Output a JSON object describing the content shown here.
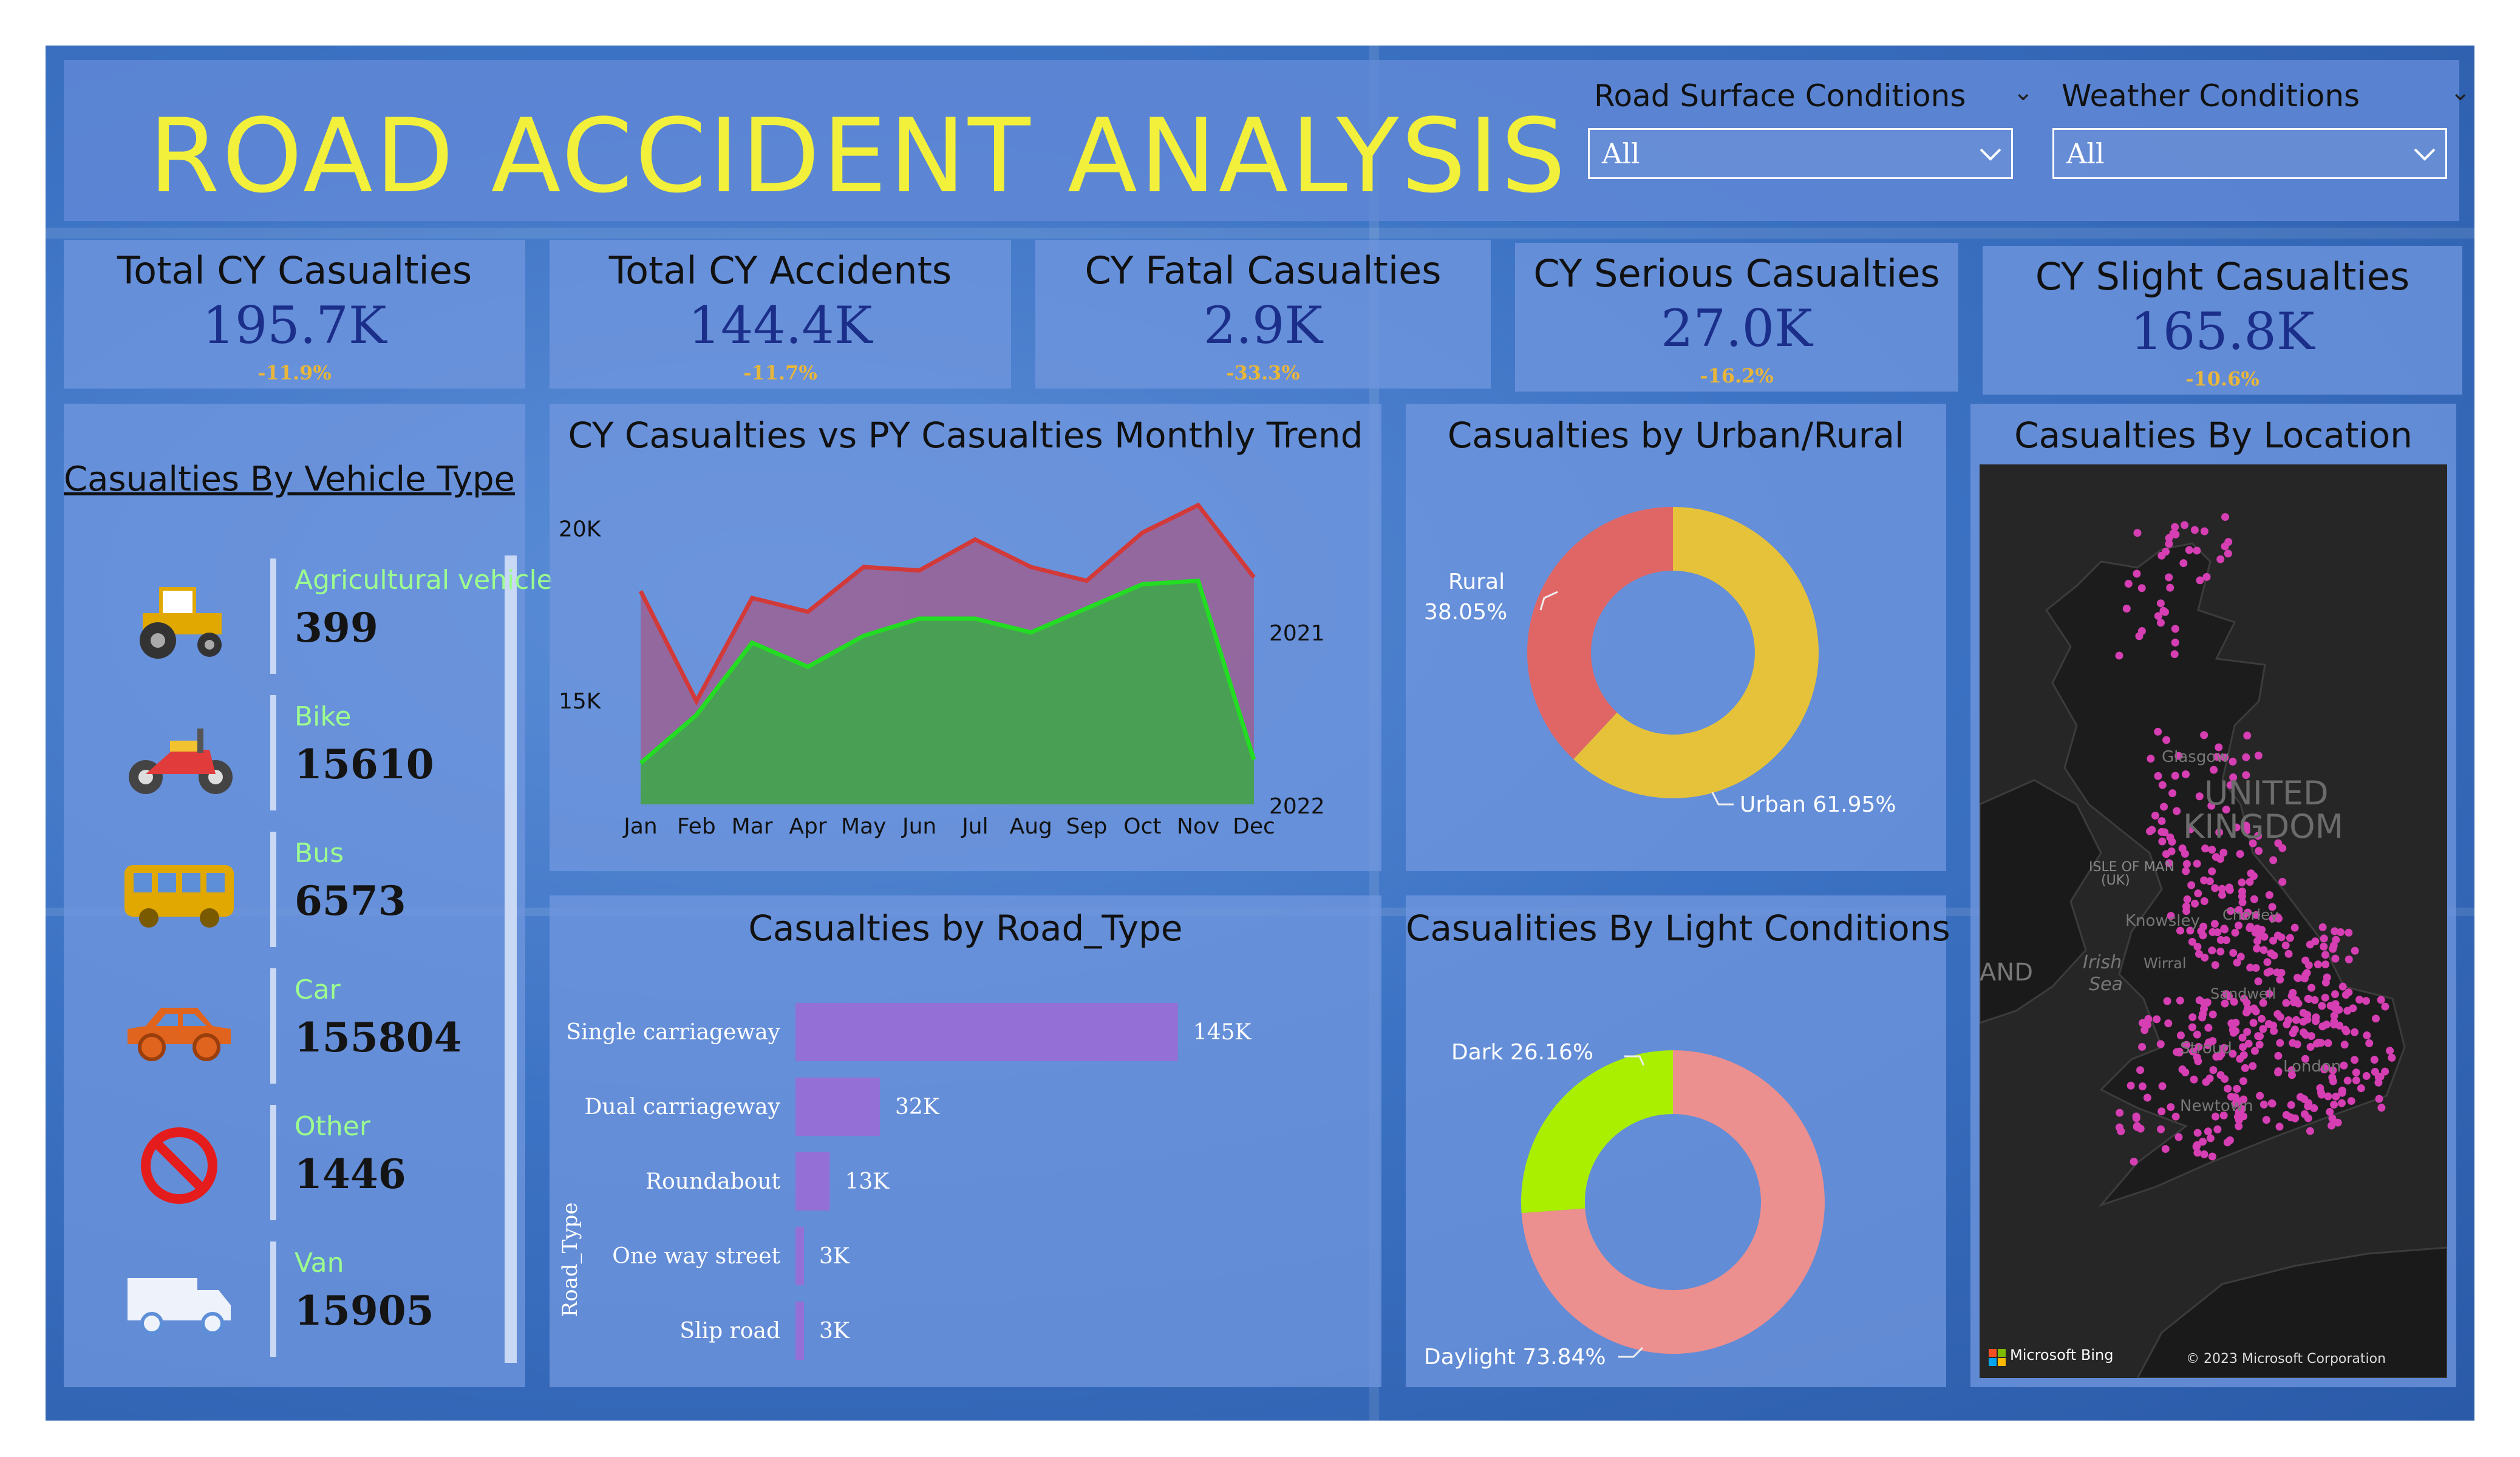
{
  "header": {
    "title": "ROAD ACCIDENT ANALYSIS"
  },
  "filters": [
    {
      "label": "Road Surface Conditions",
      "value": "All"
    },
    {
      "label": "Weather Conditions",
      "value": "All"
    }
  ],
  "kpis": [
    {
      "title": "Total CY Casualties",
      "value": "195.7K",
      "change": "-11.9%"
    },
    {
      "title": "Total CY Accidents",
      "value": "144.4K",
      "change": "-11.7%"
    },
    {
      "title": "CY Fatal Casualties",
      "value": "2.9K",
      "change": "-33.3%"
    },
    {
      "title": "CY Serious Casualties",
      "value": "27.0K",
      "change": "-16.2%"
    },
    {
      "title": "CY Slight Casualties",
      "value": "165.8K",
      "change": "-10.6%"
    }
  ],
  "vehicle_panel": {
    "title": "Casualties By Vehicle Type",
    "items": [
      {
        "label": "Agricultural vehicle",
        "value": "399",
        "icon": "tractor-icon"
      },
      {
        "label": "Bike",
        "value": "15610",
        "icon": "motorbike-icon"
      },
      {
        "label": "Bus",
        "value": "6573",
        "icon": "bus-icon"
      },
      {
        "label": "Car",
        "value": "155804",
        "icon": "car-icon"
      },
      {
        "label": "Other",
        "value": "1446",
        "icon": "no-entry-icon"
      },
      {
        "label": "Van",
        "value": "15905",
        "icon": "van-icon"
      }
    ]
  },
  "colors": {
    "title_yellow": "#f2f03a",
    "kpi_value": "#1b2f8a",
    "kpi_change": "#e8b63a",
    "py_line": "#d23a3a",
    "cy_line": "#22dd22",
    "rural": "#e06666",
    "urban": "#e6c23a",
    "dark": "#aaee00",
    "daylight": "#ec8f8f",
    "bar": "#9470d6",
    "map_point": "#d63fb3"
  },
  "chart_data": [
    {
      "type": "area",
      "title": "CY Casualties vs PY Casualties Monthly Trend",
      "x": [
        "Jan",
        "Feb",
        "Mar",
        "Apr",
        "May",
        "Jun",
        "Jul",
        "Aug",
        "Sep",
        "Oct",
        "Nov",
        "Dec"
      ],
      "y_ticks": [
        "20K",
        "15K"
      ],
      "ylim": [
        12000,
        21000
      ],
      "series": [
        {
          "name": "2021",
          "values": [
            18200,
            15000,
            18000,
            17600,
            18900,
            18800,
            19700,
            18900,
            18500,
            19900,
            20700,
            18600
          ]
        },
        {
          "name": "2022",
          "values": [
            13200,
            14600,
            16700,
            16000,
            16900,
            17400,
            17400,
            17000,
            17700,
            18400,
            18500,
            13300
          ]
        }
      ]
    },
    {
      "type": "pie",
      "title": "Casualties by Urban/Rural",
      "labels": [
        "Urban",
        "Rural"
      ],
      "values": [
        61.95,
        38.05
      ],
      "data_labels": [
        "Urban 61.95%",
        "Rural",
        "38.05%"
      ]
    },
    {
      "type": "bar",
      "title": "Casualties by Road_Type",
      "ylabel": "Road_Type",
      "categories": [
        "Single carriageway",
        "Dual carriageway",
        "Roundabout",
        "One way street",
        "Slip road"
      ],
      "values": [
        145,
        32,
        13,
        3,
        3
      ],
      "data_labels": [
        "145K",
        "32K",
        "13K",
        "3K",
        "3K"
      ]
    },
    {
      "type": "pie",
      "title": "Casualities By Light Conditions",
      "labels": [
        "Daylight",
        "Dark"
      ],
      "values": [
        73.84,
        26.16
      ],
      "data_labels": [
        "Daylight 73.84%",
        "Dark 26.16%"
      ]
    }
  ],
  "map": {
    "title": "Casualties By Location",
    "country_label_1": "UNITED",
    "country_label_2": "KINGDOM",
    "place_labels": [
      "Glasgow",
      "ISLE OF MAN",
      "(UK)",
      "Knowsley",
      "Irish",
      "Sea",
      "Chorley",
      "Wirral",
      "Sandwell",
      "Stroud",
      "London",
      "Newtown",
      "AND"
    ],
    "bing_label": "Microsoft Bing",
    "copyright": "© 2023 Microsoft Corporation"
  }
}
